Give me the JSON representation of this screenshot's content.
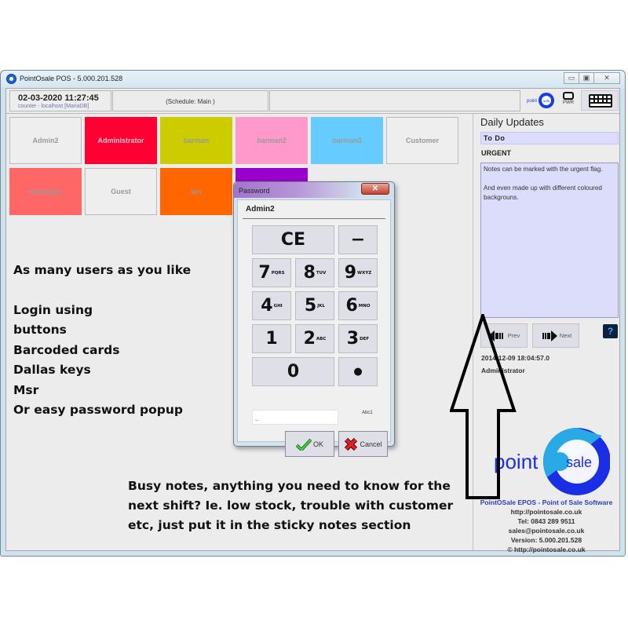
{
  "window": {
    "title": "PointOsale POS - 5.000.201.528",
    "controls": {
      "minimize": "▭",
      "restore": "▣",
      "close": "✕"
    }
  },
  "topbar": {
    "datetime": "02-03-2020 11:27:45",
    "server": "counter - localhost [MariaDB]",
    "schedule": "(Schedule: Main )",
    "logo_small_text_left": "point",
    "logo_small_text_right": "sale",
    "power_label": "PWR",
    "keyboard_icon": "keyboard-icon"
  },
  "users": [
    {
      "name": "Admin2",
      "bg": "#eeeeee"
    },
    {
      "name": "Administrator",
      "bg": "#ff0033"
    },
    {
      "name": "barman",
      "bg": "#cccc00"
    },
    {
      "name": "barman2",
      "bg": "#ff99cc"
    },
    {
      "name": "barman3",
      "bg": "#66ccff"
    },
    {
      "name": "Customer",
      "bg": "#eeeeee"
    },
    {
      "name": "employee",
      "bg": "#ff6666"
    },
    {
      "name": "Guest",
      "bg": "#eeeeee"
    },
    {
      "name": "ian",
      "bg": "#ff6600"
    },
    {
      "name": "",
      "bg": "#9900cc"
    }
  ],
  "annotations": {
    "left_lines": [
      "As many users as you like",
      "",
      "Login using",
      "buttons",
      "Barcoded cards",
      "Dallas keys",
      "Msr",
      "Or easy password popup"
    ],
    "bottom_lines": [
      "Busy notes, anything you need to know for the",
      "next shift? Ie. low stock, trouble with customer",
      "etc, just put it in the sticky notes section"
    ]
  },
  "daily_updates": {
    "title": "Daily Updates",
    "todo": "To Do",
    "urgent_label": "URGENT",
    "note_line1": "Notes can be marked with the urgent flag.",
    "note_line2": "And even made up with different coloured backgrouns.",
    "prev": "Prev",
    "next": "Next",
    "help": "?",
    "note_date": "2014-12-09 18:04:57.0",
    "note_user": "Administrator"
  },
  "branding": {
    "logo_left": "point",
    "logo_right": "sale",
    "tagline": "PointOSale EPOS - Point of Sale Software",
    "website": "http://pointosale.co.uk",
    "tel": "Tel: 0843 289 9511",
    "email": "sales@pointosale.co.uk",
    "version": "Version: 5.000.201.528",
    "copyright": "© http://pointosale.co.uk"
  },
  "password_dialog": {
    "title": "Password",
    "close": "✕",
    "user": "Admin2",
    "keys": {
      "ce": "CE",
      "minus": "−",
      "k7": "7",
      "k7sub": "PQRS",
      "k8": "8",
      "k8sub": "TUV",
      "k9": "9",
      "k9sub": "WXYZ",
      "k4": "4",
      "k4sub": "GHI",
      "k5": "5",
      "k5sub": "JKL",
      "k6": "6",
      "k6sub": "MNO",
      "k1": "1",
      "k2": "2",
      "k2sub": "ABC",
      "k3": "3",
      "k3sub": "DEF",
      "k0": "0",
      "dot": "●"
    },
    "input_value": "_",
    "input_mode": "Abc1",
    "ok": "OK",
    "cancel": "Cancel"
  }
}
